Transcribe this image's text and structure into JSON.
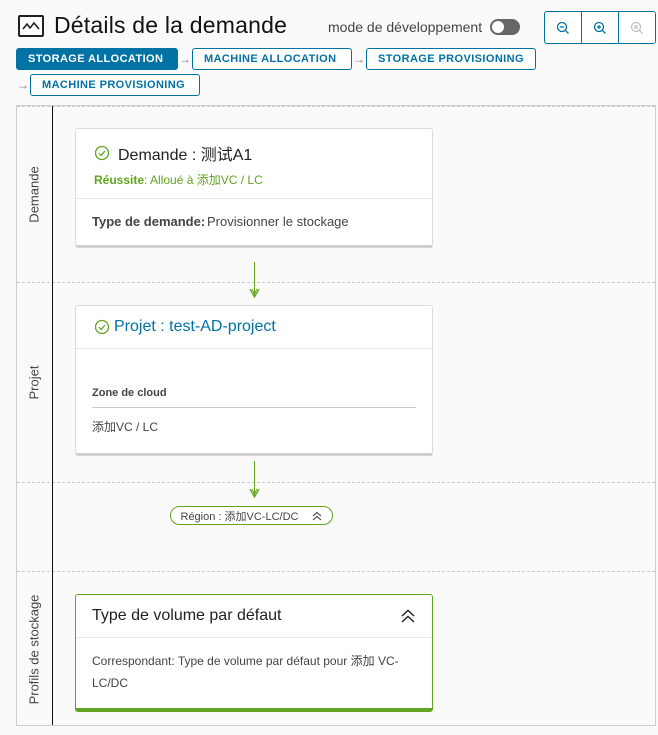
{
  "header": {
    "title": "Détails de la demande",
    "title_icon": "line-chart-icon",
    "dev_mode_label": "mode de développement",
    "dev_mode_enabled": false,
    "zoom_controls": [
      {
        "name": "zoom-out",
        "icon": "zoom-out-icon",
        "enabled": true
      },
      {
        "name": "zoom-in",
        "icon": "zoom-in-icon",
        "enabled": true
      },
      {
        "name": "zoom-reset",
        "icon": "zoom-reset-icon",
        "enabled": false
      }
    ]
  },
  "tabs": [
    {
      "label": "STORAGE ALLOCATION",
      "active": true
    },
    {
      "label": "MACHINE ALLOCATION",
      "active": false
    },
    {
      "label": "STORAGE PROVISIONING",
      "active": false
    },
    {
      "label": "MACHINE PROVISIONING",
      "active": false
    }
  ],
  "lanes": [
    {
      "label": "Demande"
    },
    {
      "label": "Projet"
    },
    {
      "label": "Profils de stockage"
    }
  ],
  "request_card": {
    "title": "Demande : 测试A1",
    "status_label": "Réussite",
    "status_text": ": Alloué à 添加VC / LC",
    "field_label": "Type de demande:",
    "field_value": "Provisionner le stockage"
  },
  "project_card": {
    "title": "Projet : test-AD-project",
    "zone_label": "Zone de cloud",
    "zone_value": "添加VC / LC"
  },
  "region_pill": {
    "label": "Région : 添加VC-LC/DC",
    "icon": "double-chevron-up-icon"
  },
  "volume_card": {
    "title": "Type de volume par défaut",
    "body": "Correspondant: Type de volume par défaut pour 添加 VC-LC/DC",
    "icon": "double-chevron-up-icon"
  },
  "colors": {
    "primary": "#0072a3",
    "success": "#62a420",
    "toggle_off": "#666666"
  }
}
